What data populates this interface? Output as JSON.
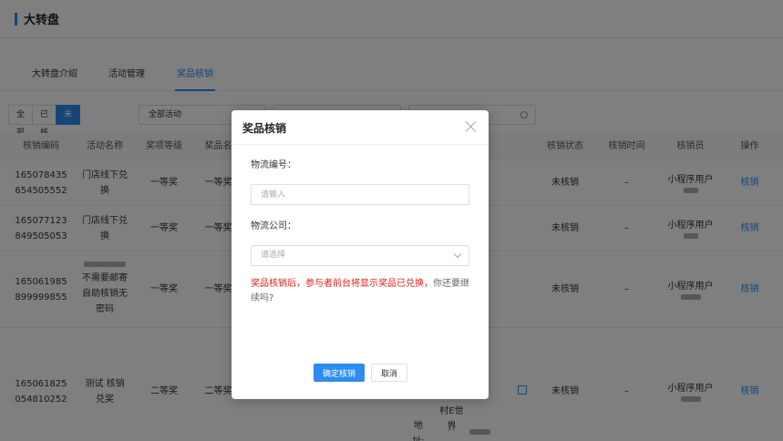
{
  "page": {
    "title": "大转盘"
  },
  "tabs": [
    {
      "label": "大转盘介绍"
    },
    {
      "label": "活动管理"
    },
    {
      "label": "奖品核销"
    }
  ],
  "filters": {
    "status_tabs": [
      {
        "label": "全部"
      },
      {
        "label": "已核销"
      },
      {
        "label": "未核销"
      }
    ],
    "activity_select": "全部活动"
  },
  "table": {
    "headers": [
      "核销编码",
      "活动名称",
      "奖项等级",
      "奖品名",
      "核销状态",
      "核销时间",
      "核销员",
      "操作"
    ],
    "rows": [
      {
        "code": "165078435\n654505552",
        "activity": "门店线下兑\n换",
        "level": "一等奖",
        "prize": "一等奖",
        "status": "未核销",
        "time": "–",
        "operator": "小程序用户",
        "action": "核销"
      },
      {
        "code": "165077123\n849505053",
        "activity": "门店线下兑\n换",
        "level": "一等奖",
        "prize": "一等奖",
        "status": "未核销",
        "time": "–",
        "operator": "小程序用户",
        "action": "核销"
      },
      {
        "code": "165061985\n899999855",
        "activity": "不需要邮寄\n自助核销无\n密码",
        "level": "一等奖",
        "prize": "一等奖",
        "status": "未核销",
        "time": "–",
        "operator": "小程序用户",
        "action": "核销"
      },
      {
        "code": "165061825\n054810252",
        "activity": "测试 核销\n兑奖",
        "level": "二等奖",
        "prize": "二等奖",
        "status": "未核销",
        "time": "–",
        "operator": "小程序用户",
        "action": "核销",
        "address_label": "地\n址:",
        "address_text": "村E世界"
      }
    ]
  },
  "modal": {
    "title": "奖品核销",
    "logistics_no_label": "物流编号：",
    "logistics_no_placeholder": "请输入",
    "logistics_company_label": "物流公司：",
    "logistics_company_placeholder": "请选择",
    "warning_red": "奖品核销后，参与者前台将显示奖品已兑换，",
    "warning_grey": "你还要继续吗?",
    "confirm_label": "确定核销",
    "cancel_label": "取消"
  },
  "colors": {
    "primary": "#2d8cf0",
    "warning": "#e0201b"
  }
}
